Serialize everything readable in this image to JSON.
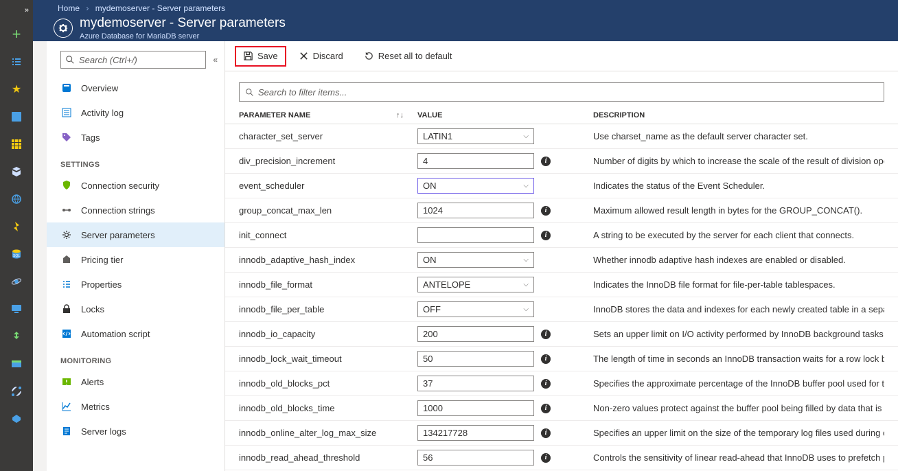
{
  "breadcrumb": {
    "home": "Home",
    "page": "mydemoserver - Server parameters"
  },
  "header": {
    "title": "mydemoserver - Server parameters",
    "subtitle": "Azure Database for MariaDB server"
  },
  "sidebar": {
    "search_placeholder": "Search (Ctrl+/)",
    "items_top": [
      {
        "label": "Overview",
        "icon": "overview"
      },
      {
        "label": "Activity log",
        "icon": "activity"
      },
      {
        "label": "Tags",
        "icon": "tags"
      }
    ],
    "section_settings": "SETTINGS",
    "items_settings": [
      {
        "label": "Connection security",
        "icon": "shield"
      },
      {
        "label": "Connection strings",
        "icon": "conn"
      },
      {
        "label": "Server parameters",
        "icon": "gear",
        "active": true
      },
      {
        "label": "Pricing tier",
        "icon": "pricing"
      },
      {
        "label": "Properties",
        "icon": "prop"
      },
      {
        "label": "Locks",
        "icon": "lock"
      },
      {
        "label": "Automation script",
        "icon": "script"
      }
    ],
    "section_monitoring": "MONITORING",
    "items_monitoring": [
      {
        "label": "Alerts",
        "icon": "alert"
      },
      {
        "label": "Metrics",
        "icon": "metrics"
      },
      {
        "label": "Server logs",
        "icon": "logs"
      }
    ]
  },
  "toolbar": {
    "save": "Save",
    "discard": "Discard",
    "reset": "Reset all to default"
  },
  "filter_placeholder": "Search to filter items...",
  "columns": {
    "name": "PARAMETER NAME",
    "value": "VALUE",
    "desc": "DESCRIPTION"
  },
  "params": [
    {
      "name": "character_set_server",
      "value": "LATIN1",
      "type": "select",
      "desc": "Use charset_name as the default server character set."
    },
    {
      "name": "div_precision_increment",
      "value": "4",
      "type": "text",
      "info": true,
      "desc": "Number of digits by which to increase the scale of the result of division operation"
    },
    {
      "name": "event_scheduler",
      "value": "ON",
      "type": "select",
      "changed": true,
      "desc": "Indicates the status of the Event Scheduler."
    },
    {
      "name": "group_concat_max_len",
      "value": "1024",
      "type": "text",
      "info": true,
      "desc": "Maximum allowed result length in bytes for the GROUP_CONCAT()."
    },
    {
      "name": "init_connect",
      "value": "",
      "type": "text",
      "info": true,
      "desc": "A string to be executed by the server for each client that connects."
    },
    {
      "name": "innodb_adaptive_hash_index",
      "value": "ON",
      "type": "select",
      "desc": "Whether innodb adaptive hash indexes are enabled or disabled."
    },
    {
      "name": "innodb_file_format",
      "value": "ANTELOPE",
      "type": "select",
      "desc": "Indicates the InnoDB file format for file-per-table tablespaces."
    },
    {
      "name": "innodb_file_per_table",
      "value": "OFF",
      "type": "select",
      "desc": "InnoDB stores the data and indexes for each newly created table in a separate .ibd"
    },
    {
      "name": "innodb_io_capacity",
      "value": "200",
      "type": "text",
      "info": true,
      "desc": "Sets an upper limit on I/O activity performed by InnoDB background tasks, such a"
    },
    {
      "name": "innodb_lock_wait_timeout",
      "value": "50",
      "type": "text",
      "info": true,
      "desc": "The length of time in seconds an InnoDB transaction waits for a row lock before g"
    },
    {
      "name": "innodb_old_blocks_pct",
      "value": "37",
      "type": "text",
      "info": true,
      "desc": "Specifies the approximate percentage of the InnoDB buffer pool used for the old l"
    },
    {
      "name": "innodb_old_blocks_time",
      "value": "1000",
      "type": "text",
      "info": true,
      "desc": "Non-zero values protect against the buffer pool being filled by data that is referen"
    },
    {
      "name": "innodb_online_alter_log_max_size",
      "value": "134217728",
      "type": "text",
      "info": true,
      "desc": "Specifies an upper limit on the size of the temporary log files used during online D"
    },
    {
      "name": "innodb_read_ahead_threshold",
      "value": "56",
      "type": "text",
      "info": true,
      "desc": "Controls the sensitivity of linear read-ahead that InnoDB uses to prefetch pages in"
    }
  ]
}
